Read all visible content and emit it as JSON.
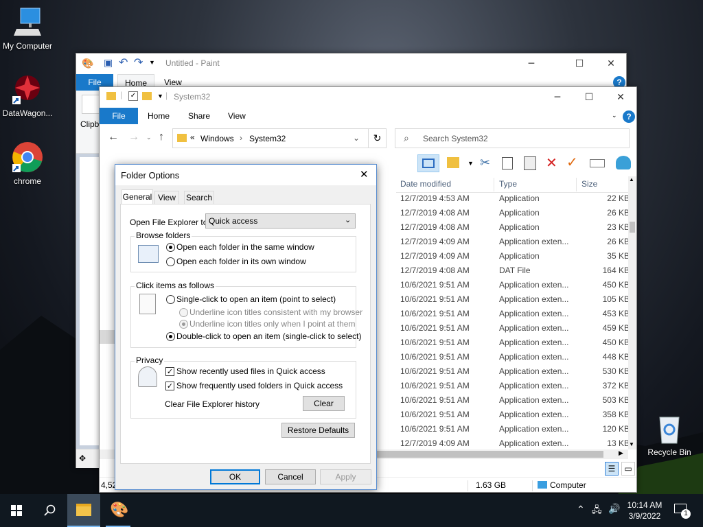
{
  "desktop": {
    "icons": [
      {
        "label": "My Computer"
      },
      {
        "label": "DataWagon..."
      },
      {
        "label": "chrome"
      },
      {
        "label": "Recycle Bin"
      }
    ]
  },
  "paint": {
    "title": "Untitled - Paint",
    "tabs": [
      "File",
      "Home",
      "View"
    ],
    "clipboard_label": "Clipb",
    "status_left": "4,",
    "status_left2": "4,52"
  },
  "explorer": {
    "title": "System32",
    "tabs": [
      "File",
      "Home",
      "Share",
      "View"
    ],
    "breadcrumb": {
      "prefix": "«",
      "parts": [
        "Windows",
        "System32"
      ]
    },
    "search_placeholder": "Search System32",
    "columns": {
      "date": "Date modified",
      "type": "Type",
      "size": "Size"
    },
    "rows": [
      {
        "date": "12/7/2019 4:53 AM",
        "type": "Application",
        "size": "22 KB"
      },
      {
        "date": "12/7/2019 4:08 AM",
        "type": "Application",
        "size": "26 KB"
      },
      {
        "date": "12/7/2019 4:08 AM",
        "type": "Application",
        "size": "23 KB"
      },
      {
        "date": "12/7/2019 4:09 AM",
        "type": "Application exten...",
        "size": "26 KB"
      },
      {
        "date": "12/7/2019 4:09 AM",
        "type": "Application",
        "size": "35 KB"
      },
      {
        "date": "12/7/2019 4:08 AM",
        "type": "DAT File",
        "size": "164 KB"
      },
      {
        "date": "10/6/2021 9:51 AM",
        "type": "Application exten...",
        "size": "450 KB"
      },
      {
        "date": "10/6/2021 9:51 AM",
        "type": "Application exten...",
        "size": "105 KB"
      },
      {
        "date": "10/6/2021 9:51 AM",
        "type": "Application exten...",
        "size": "453 KB"
      },
      {
        "date": "10/6/2021 9:51 AM",
        "type": "Application exten...",
        "size": "459 KB"
      },
      {
        "date": "10/6/2021 9:51 AM",
        "type": "Application exten...",
        "size": "450 KB"
      },
      {
        "date": "10/6/2021 9:51 AM",
        "type": "Application exten...",
        "size": "448 KB"
      },
      {
        "date": "10/6/2021 9:51 AM",
        "type": "Application exten...",
        "size": "530 KB"
      },
      {
        "date": "10/6/2021 9:51 AM",
        "type": "Application exten...",
        "size": "372 KB"
      },
      {
        "date": "10/6/2021 9:51 AM",
        "type": "Application exten...",
        "size": "503 KB"
      },
      {
        "date": "10/6/2021 9:51 AM",
        "type": "Application exten...",
        "size": "358 KB"
      },
      {
        "date": "10/6/2021 9:51 AM",
        "type": "Application exten...",
        "size": "120 KB"
      },
      {
        "date": "12/7/2019 4:09 AM",
        "type": "Application exten...",
        "size": "13 KB"
      }
    ],
    "status_size": "1.63 GB",
    "status_location": "Computer"
  },
  "dialog": {
    "title": "Folder Options",
    "tabs": [
      "General",
      "View",
      "Search"
    ],
    "open_label": "Open File Explorer to:",
    "open_value": "Quick access",
    "browse": {
      "title": "Browse folders",
      "opt1": "Open each folder in the same window",
      "opt2": "Open each folder in its own window"
    },
    "click": {
      "title": "Click items as follows",
      "opt1": "Single-click to open an item (point to select)",
      "sub1": "Underline icon titles consistent with my browser",
      "sub2": "Underline icon titles only when I point at them",
      "opt2": "Double-click to open an item (single-click to select)"
    },
    "privacy": {
      "title": "Privacy",
      "chk1": "Show recently used files in Quick access",
      "chk2": "Show frequently used folders in Quick access",
      "clear_label": "Clear File Explorer history",
      "clear_btn": "Clear"
    },
    "restore_btn": "Restore Defaults",
    "ok": "OK",
    "cancel": "Cancel",
    "apply": "Apply"
  },
  "taskbar": {
    "time": "10:14 AM",
    "date": "3/9/2022",
    "notif_count": "1"
  },
  "colors": {
    "accent": "#1979ca",
    "taskbar": "#101820",
    "red_x": "#d42020",
    "check_orange": "#e06a10"
  }
}
